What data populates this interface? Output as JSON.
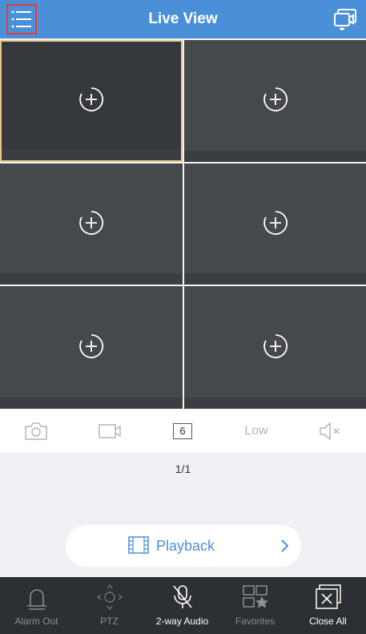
{
  "header": {
    "title": "Live View",
    "background": "#4a90d9"
  },
  "grid": {
    "cells": [
      {
        "icon": "add-camera-icon",
        "selected": true
      },
      {
        "icon": "add-camera-icon",
        "selected": false
      },
      {
        "icon": "add-camera-icon",
        "selected": false
      },
      {
        "icon": "add-camera-icon",
        "selected": false
      },
      {
        "icon": "add-camera-icon",
        "selected": false
      },
      {
        "icon": "add-camera-icon",
        "selected": false
      }
    ],
    "selected_border": "#e8c98a"
  },
  "toolbar": {
    "snapshot_icon": "camera-icon",
    "record_icon": "video-record-icon",
    "split_count": "6",
    "quality": "Low",
    "mute_icon": "speaker-mute-icon"
  },
  "pager": {
    "page": "1/1"
  },
  "playback": {
    "label": "Playback",
    "icon": "film-icon",
    "accent": "#4a90d9"
  },
  "bottom_bar": {
    "items": [
      {
        "label": "Alarm Out",
        "icon": "alarm-light-icon",
        "enabled": false
      },
      {
        "label": "PTZ",
        "icon": "ptz-icon",
        "enabled": false
      },
      {
        "label": "2-way Audio",
        "icon": "microphone-off-icon",
        "enabled": true
      },
      {
        "label": "Favorites",
        "icon": "favorites-icon",
        "enabled": false
      },
      {
        "label": "Close All",
        "icon": "close-all-icon",
        "enabled": true
      }
    ]
  }
}
